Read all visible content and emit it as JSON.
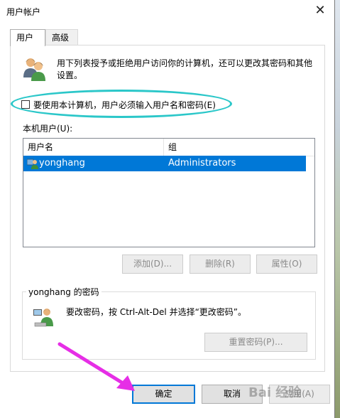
{
  "window": {
    "title": "用户帐户",
    "close_glyph": "✕"
  },
  "tabs": [
    {
      "label": "用户",
      "active": true
    },
    {
      "label": "高级",
      "active": false
    }
  ],
  "intro_text": "用下列表授予或拒绝用户访问你的计算机，还可以更改其密码和其他设置。",
  "require_login": {
    "label": "要使用本计算机，用户必须输入用户名和密码(E)",
    "checked": false
  },
  "users_label": "本机用户(U):",
  "table": {
    "columns": [
      "用户名",
      "组"
    ],
    "rows": [
      {
        "username": "yonghang",
        "group": "Administrators",
        "selected": true
      }
    ]
  },
  "list_buttons": {
    "add": "添加(D)...",
    "remove": "删除(R)",
    "properties": "属性(O)"
  },
  "password_group": {
    "title": "yonghang 的密码",
    "text": "要改密码，按 Ctrl-Alt-Del 并选择“更改密码”。",
    "reset_button": "重置密码(P)..."
  },
  "dialog_buttons": {
    "ok": "确定",
    "cancel": "取消",
    "apply": "应用(A)"
  },
  "watermark": "Bai 经验",
  "colors": {
    "selection": "#0078d7",
    "highlight_ellipse": "#2bc7c9",
    "arrow": "#e62ee6"
  }
}
